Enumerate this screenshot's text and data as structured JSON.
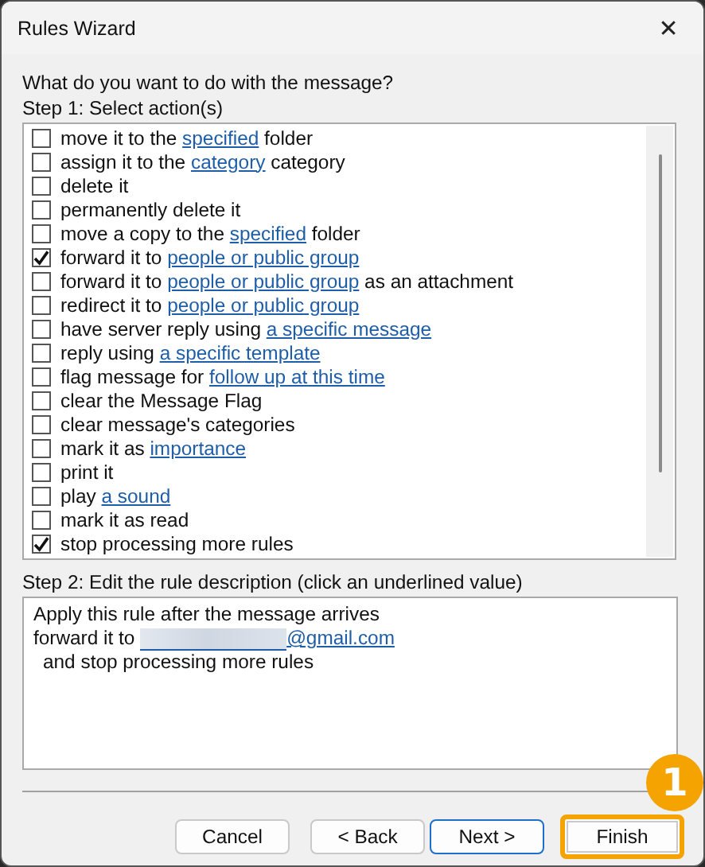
{
  "window": {
    "title": "Rules Wizard",
    "close": "✕"
  },
  "question": "What do you want to do with the message?",
  "step1": {
    "label": "Step 1: Select action(s)",
    "actions": [
      {
        "before": "move it to the ",
        "link": "specified",
        "after": " folder",
        "checked": false
      },
      {
        "before": "assign it to the ",
        "link": "category",
        "after": " category",
        "checked": false
      },
      {
        "before": "delete it",
        "checked": false
      },
      {
        "before": "permanently delete it",
        "checked": false
      },
      {
        "before": "move a copy to the ",
        "link": "specified",
        "after": " folder",
        "checked": false
      },
      {
        "before": "forward it to ",
        "link": "people or public group",
        "checked": true
      },
      {
        "before": "forward it to ",
        "link": "people or public group",
        "after": " as an attachment",
        "checked": false
      },
      {
        "before": "redirect it to ",
        "link": "people or public group",
        "checked": false
      },
      {
        "before": "have server reply using ",
        "link": "a specific message",
        "checked": false
      },
      {
        "before": "reply using ",
        "link": "a specific template",
        "checked": false
      },
      {
        "before": "flag message for ",
        "link": "follow up at this time",
        "checked": false
      },
      {
        "before": "clear the Message Flag",
        "checked": false
      },
      {
        "before": "clear message's categories",
        "checked": false
      },
      {
        "before": "mark it as ",
        "link": "importance",
        "checked": false
      },
      {
        "before": "print it",
        "checked": false
      },
      {
        "before": "play ",
        "link": "a sound",
        "checked": false
      },
      {
        "before": "mark it as read",
        "checked": false
      },
      {
        "before": "stop processing more rules",
        "checked": true
      }
    ]
  },
  "step2": {
    "label": "Step 2: Edit the rule description (click an underlined value)",
    "lines": [
      {
        "kind": "plain",
        "text": "Apply this rule after the message arrives"
      },
      {
        "kind": "redacted-link",
        "text": "forward it to ",
        "link": "@gmail.com"
      },
      {
        "kind": "indent",
        "text": "and stop processing more rules"
      }
    ]
  },
  "buttons": [
    {
      "label": "Cancel",
      "highlighted": false,
      "default": false
    },
    {
      "label": "< Back",
      "highlighted": false,
      "default": false
    },
    {
      "label": "Next >",
      "highlighted": false,
      "default": true
    },
    {
      "label": "Finish",
      "highlighted": true,
      "default": false
    }
  ],
  "callout": {
    "label": "1"
  }
}
